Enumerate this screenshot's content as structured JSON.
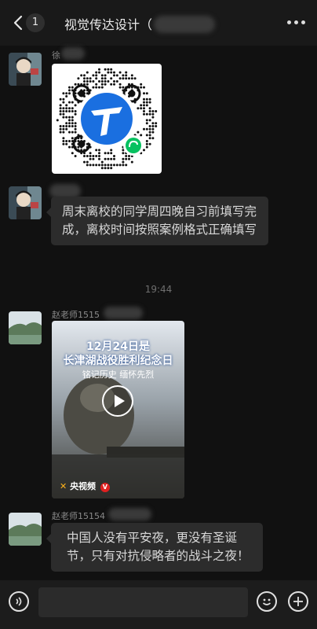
{
  "header": {
    "unread_count": "1",
    "title": "视觉传达设计（"
  },
  "messages": [
    {
      "sender": "徐",
      "type": "qr-code"
    },
    {
      "sender": "",
      "text": "周末离校的同学周四晚自习前填写完成，离校时间按照案例格式正确填写"
    },
    {
      "divider": "19:44"
    },
    {
      "sender": "赵老师1515",
      "type": "video",
      "video": {
        "headline_date": "12月24日是",
        "headline_title": "长津湖战役胜利纪念日",
        "subtitle": "铭记历史 缅怀先烈",
        "brand": "央视频",
        "badge": "V"
      }
    },
    {
      "sender": "赵老师15154",
      "text": "中国人没有平安夜，更没有圣诞节，只有对抗侵略者的战斗之夜！"
    }
  ],
  "colors": {
    "background": "#111111",
    "bubble": "#2c2c2c",
    "header": "#191919",
    "qr_blue": "#1a6fe0",
    "mini_program_green": "#07c160"
  }
}
